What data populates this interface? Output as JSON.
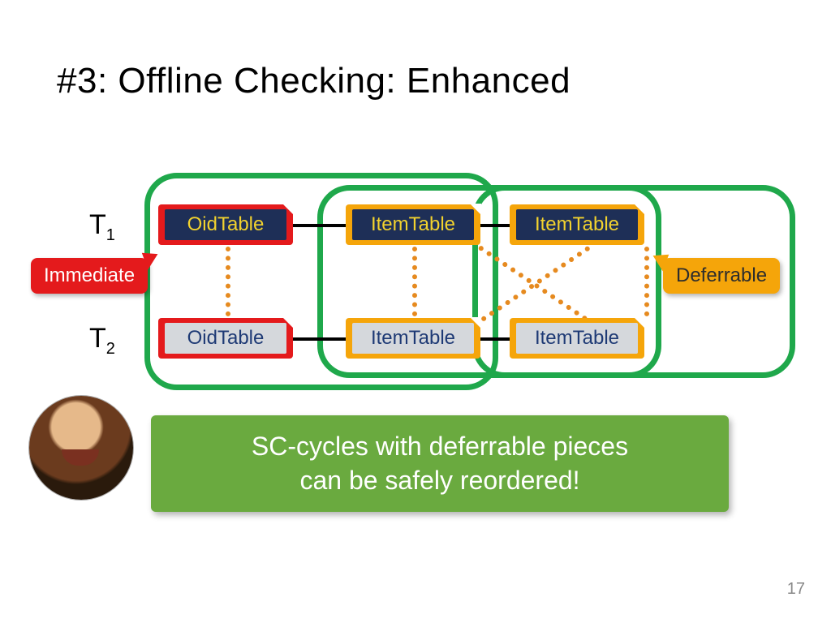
{
  "title": "#3: Offline Checking: Enhanced",
  "rows": {
    "t1": "T",
    "t1_sub": "1",
    "t2": "T",
    "t2_sub": "2"
  },
  "nodes": {
    "r1c1": "OidTable",
    "r1c2": "ItemTable",
    "r1c3": "ItemTable",
    "r2c1": "OidTable",
    "r2c2": "ItemTable",
    "r2c3": "ItemTable"
  },
  "tags": {
    "immediate": "Immediate",
    "deferrable": "Deferrable"
  },
  "banner_line1": "SC-cycles with deferrable pieces",
  "banner_line2": "can be safely reordered!",
  "page": "17",
  "colors": {
    "green_border": "#1fa84b",
    "red": "#e41a1c",
    "yellow": "#f5a50a",
    "navy": "#1e2f57",
    "label_yellow": "#f2d22e",
    "grey_fill": "#d5d8dc",
    "dark_blue_text": "#1e3a75",
    "orange_dotted": "#e68a1f",
    "banner_green": "#6aaa3f"
  }
}
